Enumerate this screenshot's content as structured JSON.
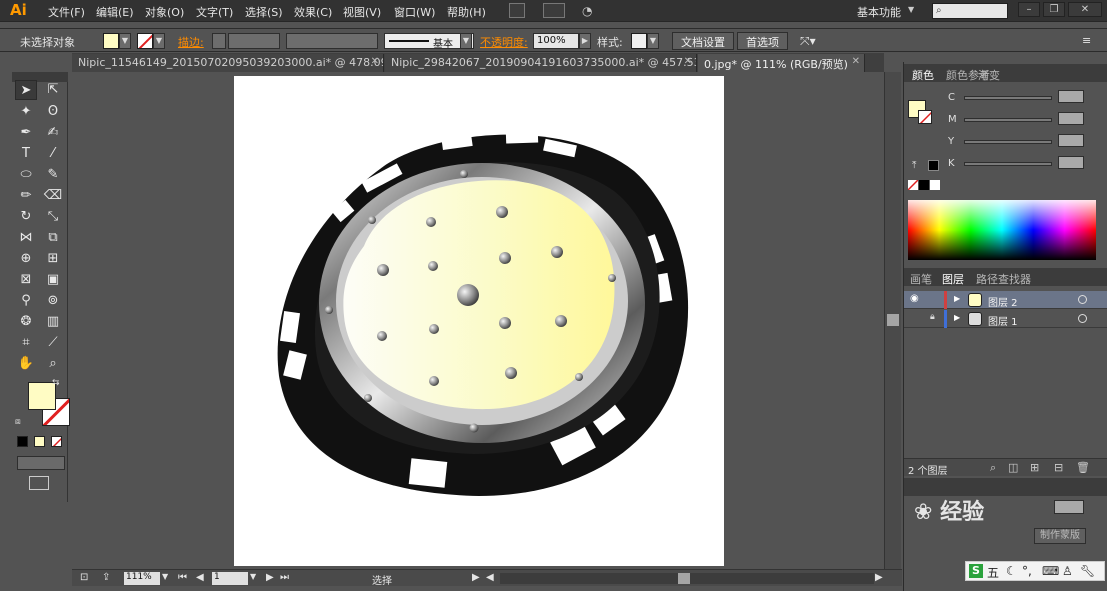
{
  "app": {
    "logo": "Ai"
  },
  "menu": [
    "文件(F)",
    "编辑(E)",
    "对象(O)",
    "文字(T)",
    "选择(S)",
    "效果(C)",
    "视图(V)",
    "窗口(W)",
    "帮助(H)"
  ],
  "workspace": "基本功能",
  "control": {
    "selection": "未选择对象",
    "stroke_label": "描边:",
    "stroke_style": "基本",
    "opacity_label": "不透明度:",
    "opacity_value": "100%",
    "style_label": "样式:",
    "doc_setup": "文档设置",
    "preferences": "首选项"
  },
  "tabs": [
    {
      "label": "Nipic_11546149_20150702095039203000.ai* @ 478.09..."
    },
    {
      "label": "Nipic_29842067_20190904191603735000.ai* @ 457.53%..."
    },
    {
      "label": "0.jpg* @ 111% (RGB/预览)"
    }
  ],
  "colors": {
    "fill": "#fffcc4",
    "accent_orange": "#ff8c00",
    "layer2_bar": "#d04040",
    "layer1_bar": "#3f6fd8"
  },
  "color_panel": {
    "tabs": [
      "颜色",
      "颜色参考",
      "渐变"
    ],
    "channels": [
      "C",
      "M",
      "Y",
      "K"
    ]
  },
  "layers_panel": {
    "tabs": [
      "画笔",
      "图层",
      "路径查找器"
    ],
    "layers": [
      {
        "name": "图层 2"
      },
      {
        "name": "图层 1"
      }
    ],
    "count": "2 个图层"
  },
  "lower_panel": {
    "button": "制作蒙版"
  },
  "watermark": "经验",
  "status": {
    "zoom": "111%",
    "page": "1",
    "mode": "选择"
  },
  "ime": {
    "label": "五"
  }
}
